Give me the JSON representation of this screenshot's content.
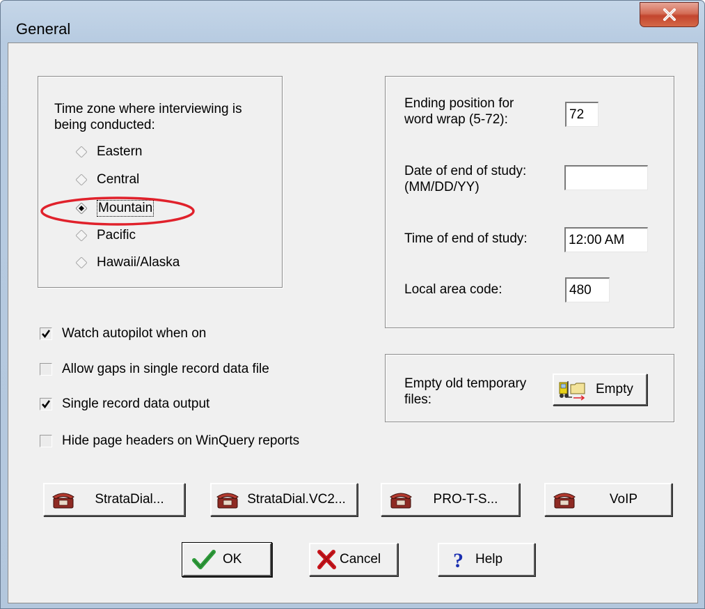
{
  "window": {
    "title": "General",
    "close_symbol": "✕"
  },
  "time_zone": {
    "label_line1": "Time zone where interviewing is",
    "label_line2": "being conducted:",
    "options": [
      {
        "label": "Eastern",
        "selected": false
      },
      {
        "label": "Central",
        "selected": false
      },
      {
        "label": "Mountain",
        "selected": true
      },
      {
        "label": "Pacific",
        "selected": false
      },
      {
        "label": "Hawaii/Alaska",
        "selected": false
      }
    ]
  },
  "study": {
    "word_wrap_line1": "Ending position for",
    "word_wrap_line2": "word wrap (5-72):",
    "word_wrap_value": "72",
    "end_date_line1": "Date of end of study:",
    "end_date_line2": "(MM/DD/YY)",
    "end_date_value": "",
    "end_time_label": "Time of end of study:",
    "end_time_value": "12:00 AM",
    "area_code_label": "Local area code:",
    "area_code_value": "480"
  },
  "options": [
    {
      "label": "Watch autopilot when on",
      "checked": true
    },
    {
      "label": "Allow gaps in single record data file",
      "checked": false
    },
    {
      "label": "Single record data output",
      "checked": true
    },
    {
      "label": "Hide page headers on WinQuery reports",
      "checked": false
    }
  ],
  "temp_files": {
    "label_line1": "Empty old temporary",
    "label_line2": "files:",
    "button_label": "Empty"
  },
  "dial_buttons": [
    "StrataDial...",
    "StrataDial.VC2...",
    "PRO-T-S...",
    "VoIP"
  ],
  "footer": {
    "ok": "OK",
    "cancel": "Cancel",
    "help": "Help"
  },
  "colors": {
    "highlight_ellipse": "#e0212b",
    "ok_check": "#2e9b3a",
    "cancel_x": "#c8141b",
    "help_q": "#1b2fb0"
  }
}
